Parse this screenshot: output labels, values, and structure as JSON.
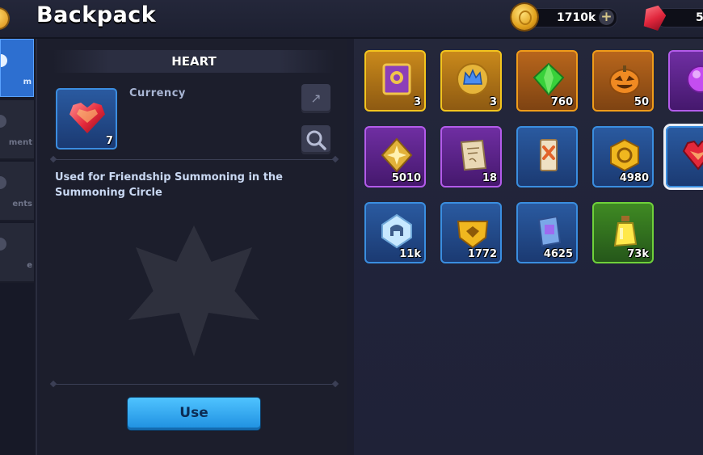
{
  "header": {
    "title": "Backpack",
    "gold": "1710k",
    "gems": "5"
  },
  "tabs": [
    {
      "label": "m",
      "active": true
    },
    {
      "label": "ment",
      "active": false
    },
    {
      "label": "ents",
      "active": false
    },
    {
      "label": "e",
      "active": false
    }
  ],
  "detail": {
    "title": "HEART",
    "category": "Currency",
    "quantity": "7",
    "description": "Used for Friendship Summoning in the Summoning Circle",
    "use_label": "Use"
  },
  "items": [
    {
      "name": "spellbook",
      "qty": "3",
      "rarity": "gold",
      "icon": "book-icon"
    },
    {
      "name": "crown-badge",
      "qty": "3",
      "rarity": "gold",
      "icon": "crown-icon"
    },
    {
      "name": "green-gem",
      "qty": "760",
      "rarity": "orange",
      "icon": "green-gem-icon"
    },
    {
      "name": "pumpkin",
      "qty": "50",
      "rarity": "orange",
      "icon": "pumpkin-icon"
    },
    {
      "name": "purple-orb",
      "qty": "",
      "rarity": "purple",
      "icon": "orb-icon"
    },
    {
      "name": "gold-star-token",
      "qty": "5010",
      "rarity": "purple",
      "icon": "star-token-icon"
    },
    {
      "name": "scroll",
      "qty": "18",
      "rarity": "purple",
      "icon": "scroll-icon"
    },
    {
      "name": "ticket",
      "qty": "",
      "rarity": "blue",
      "icon": "ticket-icon"
    },
    {
      "name": "gold-hex-token",
      "qty": "4980",
      "rarity": "blue",
      "icon": "hex-token-icon"
    },
    {
      "name": "heart",
      "qty": "",
      "rarity": "blue",
      "icon": "heart-icon",
      "selected": true
    },
    {
      "name": "helmet-crystal",
      "qty": "11k",
      "rarity": "blue",
      "icon": "helmet-crystal-icon"
    },
    {
      "name": "gold-shield-token",
      "qty": "1772",
      "rarity": "blue",
      "icon": "shield-token-icon"
    },
    {
      "name": "blue-ticket",
      "qty": "4625",
      "rarity": "blue",
      "icon": "blue-ticket-icon"
    },
    {
      "name": "yellow-potion",
      "qty": "73k",
      "rarity": "green",
      "icon": "potion-icon"
    }
  ]
}
